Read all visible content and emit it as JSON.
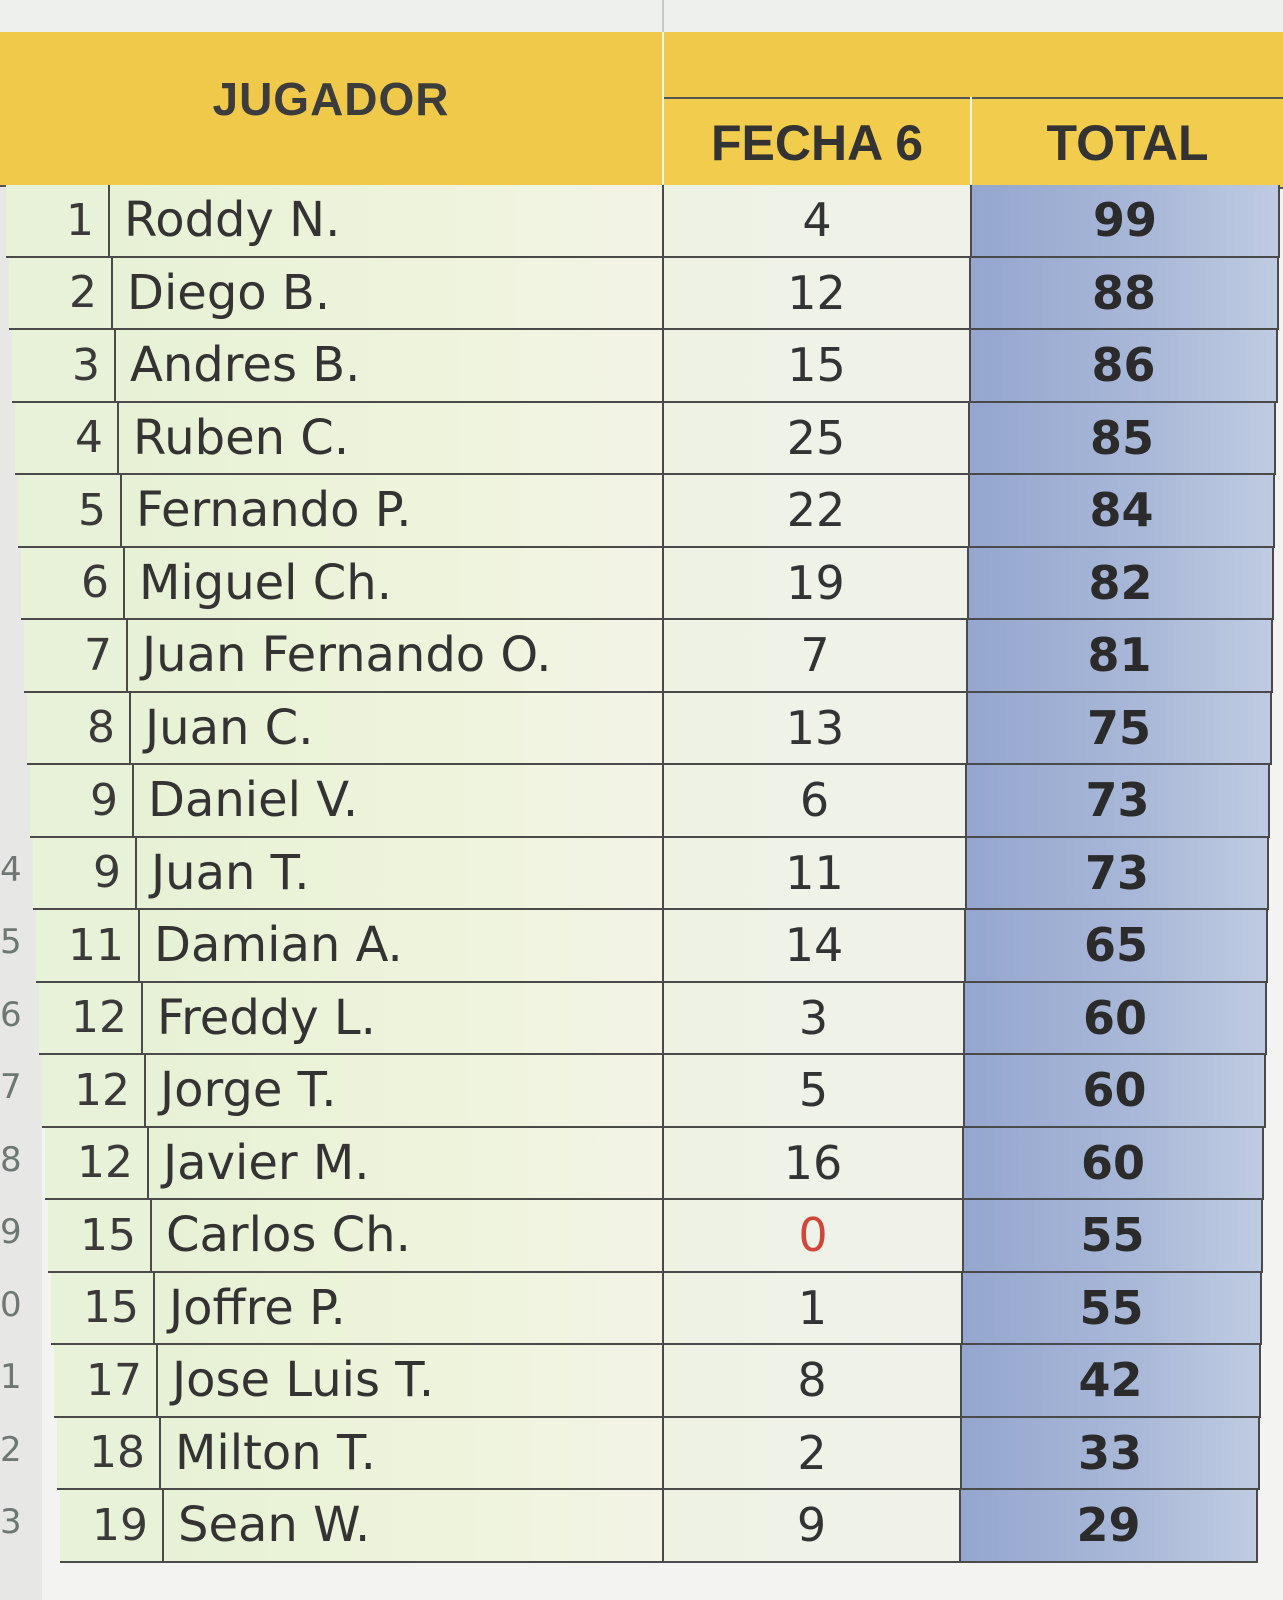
{
  "header": {
    "player_label": "JUGADOR",
    "round_label": "FECHA 6",
    "total_label": "TOTAL"
  },
  "gutter": [
    "4",
    "5",
    "6",
    "7",
    "8",
    "9",
    "0",
    "1",
    "2",
    "3"
  ],
  "rows": [
    {
      "rank": "1",
      "name": "Roddy N.",
      "fecha": "4",
      "total": "99"
    },
    {
      "rank": "2",
      "name": "Diego B.",
      "fecha": "12",
      "total": "88"
    },
    {
      "rank": "3",
      "name": "Andres B.",
      "fecha": "15",
      "total": "86"
    },
    {
      "rank": "4",
      "name": "Ruben C.",
      "fecha": "25",
      "total": "85"
    },
    {
      "rank": "5",
      "name": "Fernando P.",
      "fecha": "22",
      "total": "84"
    },
    {
      "rank": "6",
      "name": "Miguel Ch.",
      "fecha": "19",
      "total": "82"
    },
    {
      "rank": "7",
      "name": "Juan Fernando O.",
      "fecha": "7",
      "total": "81"
    },
    {
      "rank": "8",
      "name": "Juan C.",
      "fecha": "13",
      "total": "75"
    },
    {
      "rank": "9",
      "name": "Daniel V.",
      "fecha": "6",
      "total": "73"
    },
    {
      "rank": "9",
      "name": "Juan T.",
      "fecha": "11",
      "total": "73"
    },
    {
      "rank": "11",
      "name": "Damian A.",
      "fecha": "14",
      "total": "65"
    },
    {
      "rank": "12",
      "name": "Freddy L.",
      "fecha": "3",
      "total": "60"
    },
    {
      "rank": "12",
      "name": "Jorge T.",
      "fecha": "5",
      "total": "60"
    },
    {
      "rank": "12",
      "name": "Javier M.",
      "fecha": "16",
      "total": "60"
    },
    {
      "rank": "15",
      "name": "Carlos Ch.",
      "fecha": "0",
      "total": "55"
    },
    {
      "rank": "15",
      "name": "Joffre P.",
      "fecha": "1",
      "total": "55"
    },
    {
      "rank": "17",
      "name": "Jose Luis T.",
      "fecha": "8",
      "total": "42"
    },
    {
      "rank": "18",
      "name": "Milton T.",
      "fecha": "2",
      "total": "33"
    },
    {
      "rank": "19",
      "name": "Sean W.",
      "fecha": "9",
      "total": "29"
    }
  ],
  "colors": {
    "header": "#f0c84a",
    "total_column": "#95a6cf",
    "zero_value": "#d2453a"
  }
}
